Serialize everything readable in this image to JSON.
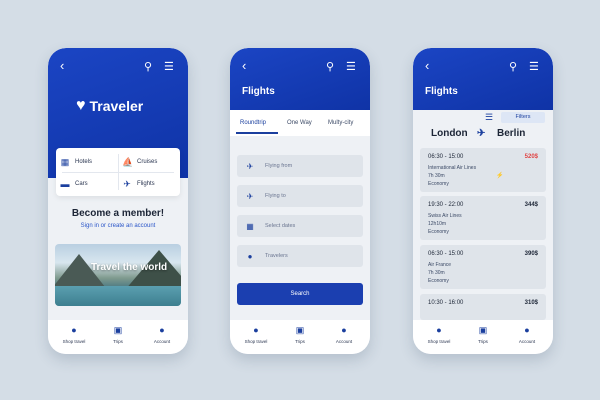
{
  "screen1": {
    "brand": "Traveler",
    "services": [
      {
        "label": "Hotels",
        "icon": "hotel-icon"
      },
      {
        "label": "Cruises",
        "icon": "ship-icon"
      },
      {
        "label": "Cars",
        "icon": "car-icon"
      },
      {
        "label": "Flights",
        "icon": "plane-icon"
      }
    ],
    "member_title": "Become a member!",
    "signin_text": "Sign in or create an account",
    "banner_text": "Travel the world",
    "nav": [
      "Shop travel",
      "Trips",
      "Account"
    ]
  },
  "screen2": {
    "title": "Flights",
    "tabs": [
      "Roundtrip",
      "One Way",
      "Multy-city"
    ],
    "fields": {
      "from_placeholder": "Flying from",
      "to_placeholder": "Flying to",
      "dates_placeholder": "Select dates",
      "travelers_placeholder": "Travelers"
    },
    "search_label": "Search",
    "nav": [
      "Shop travel",
      "Trips",
      "Account"
    ]
  },
  "screen3": {
    "title": "Flights",
    "filters_label": "Filters",
    "from_city": "London",
    "to_city": "Berlin",
    "flights": [
      {
        "time": "06:30 - 15:00",
        "price": "520$",
        "airline": "International Air Lines",
        "duration": "7h 30m",
        "class": "Economy",
        "highlight": true
      },
      {
        "time": "19:30 - 22:00",
        "price": "344$",
        "airline": "Swiss Air Lines",
        "duration": "12h10m",
        "class": "Economy",
        "highlight": false
      },
      {
        "time": "06:30 - 15:00",
        "price": "390$",
        "airline": "Air France",
        "duration": "7h 30m",
        "class": "Economy",
        "highlight": false
      },
      {
        "time": "10:30 - 16:00",
        "price": "310$"
      }
    ],
    "nav": [
      "Shop travel",
      "Trips",
      "Account"
    ]
  },
  "colors": {
    "primary": "#1b3fb0",
    "header": "#1b45c4",
    "background": "#d4dde6",
    "price_highlight": "#e04545"
  }
}
